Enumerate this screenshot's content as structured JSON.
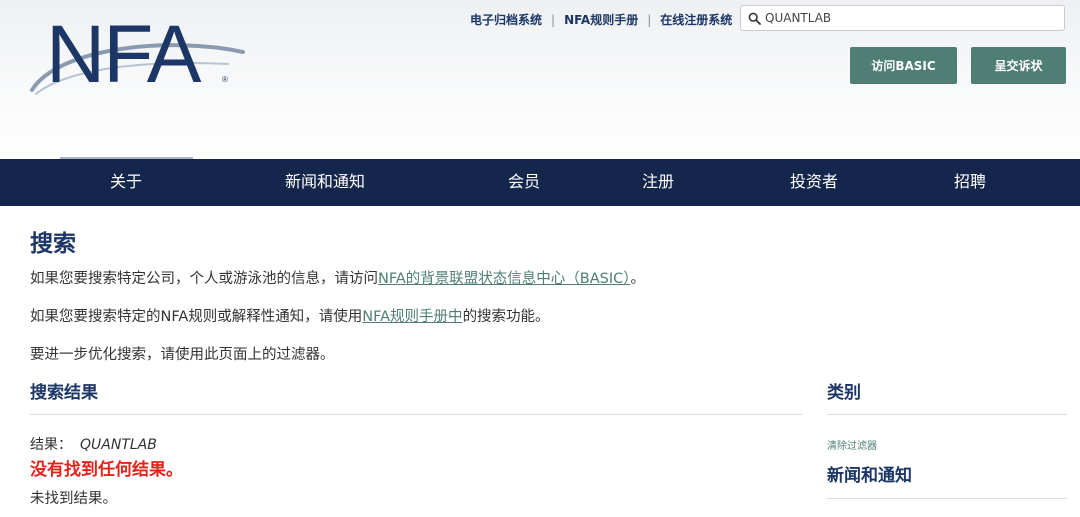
{
  "header": {
    "logo_text": "NFA",
    "top_links": [
      "电子归档系统",
      "NFA规则手册",
      "在线注册系统"
    ],
    "search": {
      "value": "QUANTLAB",
      "placeholder": ""
    },
    "buttons": {
      "basic": "访问BASIC",
      "complaint": "呈交诉状"
    }
  },
  "nav": {
    "items": [
      "关于",
      "新闻和通知",
      "会员",
      "注册",
      "投资者",
      "招聘"
    ]
  },
  "main": {
    "title": "搜索",
    "p1_prefix": "如果您要搜索特定公司，个人或游泳池的信息，请访问",
    "p1_link": "NFA的背景联盟状态信息中心（BASIC）",
    "p1_suffix": "。",
    "p2_prefix": "如果您要搜索特定的NFA规则或解释性通知，请使用",
    "p2_link": "NFA规则手册中",
    "p2_suffix": "的搜索功能。",
    "p3": "要进一步优化搜索，请使用此页面上的过滤器。",
    "results": {
      "heading": "搜索结果",
      "label": "结果：",
      "query": "QUANTLAB",
      "none_found": "没有找到任何结果。",
      "not_found": "未找到结果。"
    }
  },
  "sidebar": {
    "heading": "类别",
    "clear_filter": "清除过滤器",
    "category": "新闻和通知"
  },
  "colors": {
    "navy": "#1c3766",
    "navbar": "#14264b",
    "green_button": "#4f7f74",
    "error_red": "#e3241b"
  }
}
